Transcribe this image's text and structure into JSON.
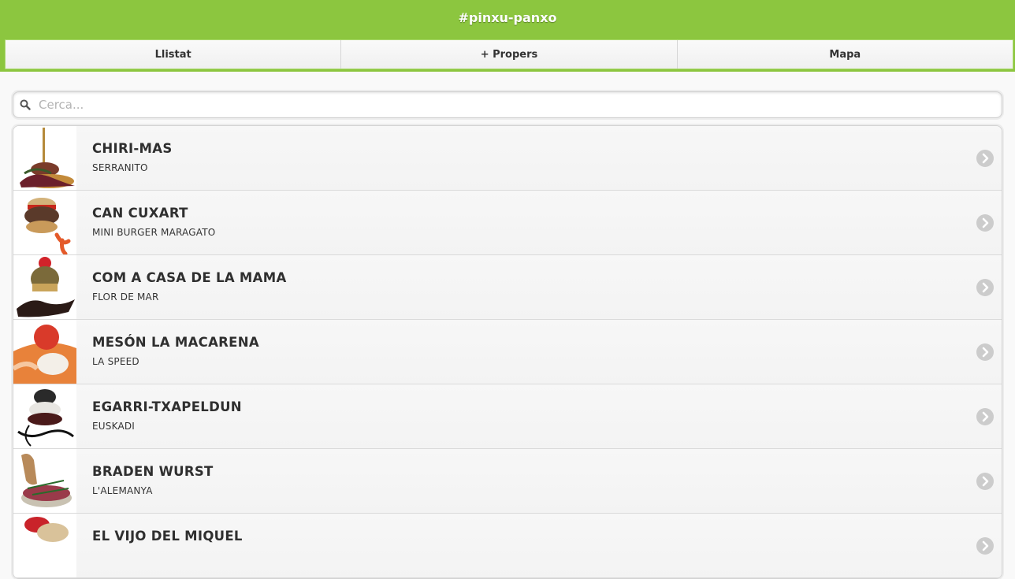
{
  "header": {
    "title": "#pinxu-panxo"
  },
  "nav": {
    "tabs": [
      {
        "label": "Llistat"
      },
      {
        "label": "+ Propers"
      },
      {
        "label": "Mapa"
      }
    ]
  },
  "search": {
    "placeholder": "Cerca...",
    "value": "",
    "icon": "search-icon"
  },
  "items": [
    {
      "title": "CHIRI-MAS",
      "subtitle": "SERRANITO"
    },
    {
      "title": "CAN CUXART",
      "subtitle": "MINI BURGER MARAGATO"
    },
    {
      "title": "COM A CASA DE LA MAMA",
      "subtitle": "FLOR DE MAR"
    },
    {
      "title": "MESÓN LA MACARENA",
      "subtitle": "LA SPEED"
    },
    {
      "title": "EGARRI-TXAPELDUN",
      "subtitle": "EUSKADI"
    },
    {
      "title": "BRADEN WURST",
      "subtitle": "L'ALEMANYA"
    },
    {
      "title": "EL VIJO DEL MIQUEL",
      "subtitle": ""
    }
  ],
  "colors": {
    "header_bg": "#8cc63f",
    "chevron": "#cccccc"
  }
}
